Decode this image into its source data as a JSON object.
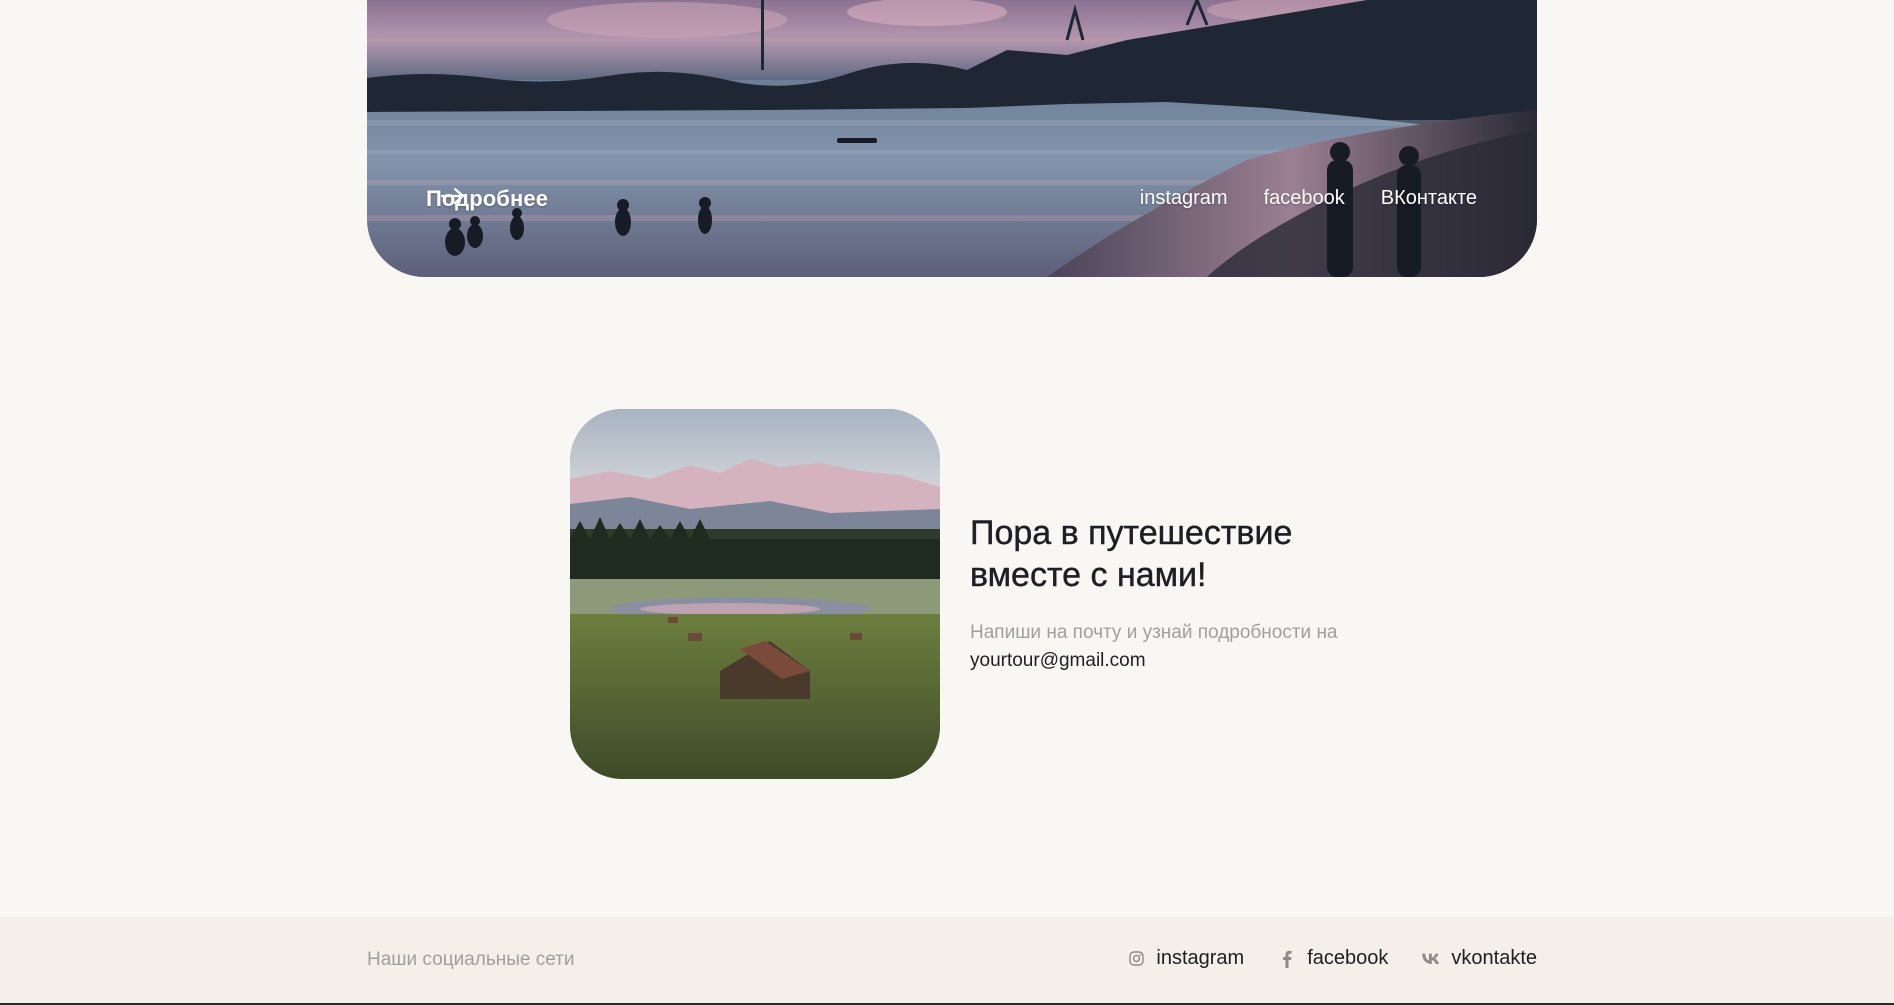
{
  "hero": {
    "more_label": "Подробнее",
    "social": [
      {
        "label": "instagram"
      },
      {
        "label": "facebook"
      },
      {
        "label": "ВКонтакте"
      }
    ]
  },
  "cta": {
    "title": "Пора в путешествие вместе с нами!",
    "text_before": "Напиши на почту и узнай подробности на",
    "email": "yourtour@gmail.com"
  },
  "footer": {
    "label": "Наши социальные сети",
    "social": [
      {
        "label": "instagram",
        "icon": "instagram-icon"
      },
      {
        "label": "facebook",
        "icon": "facebook-icon"
      },
      {
        "label": "vkontakte",
        "icon": "vk-icon"
      }
    ]
  },
  "colors": {
    "background": "#f8f7f3",
    "footer_bg": "#f4efe9",
    "text_dark": "#1d1f25",
    "text_muted": "#a19f9c",
    "hero_text": "#ffffff"
  }
}
